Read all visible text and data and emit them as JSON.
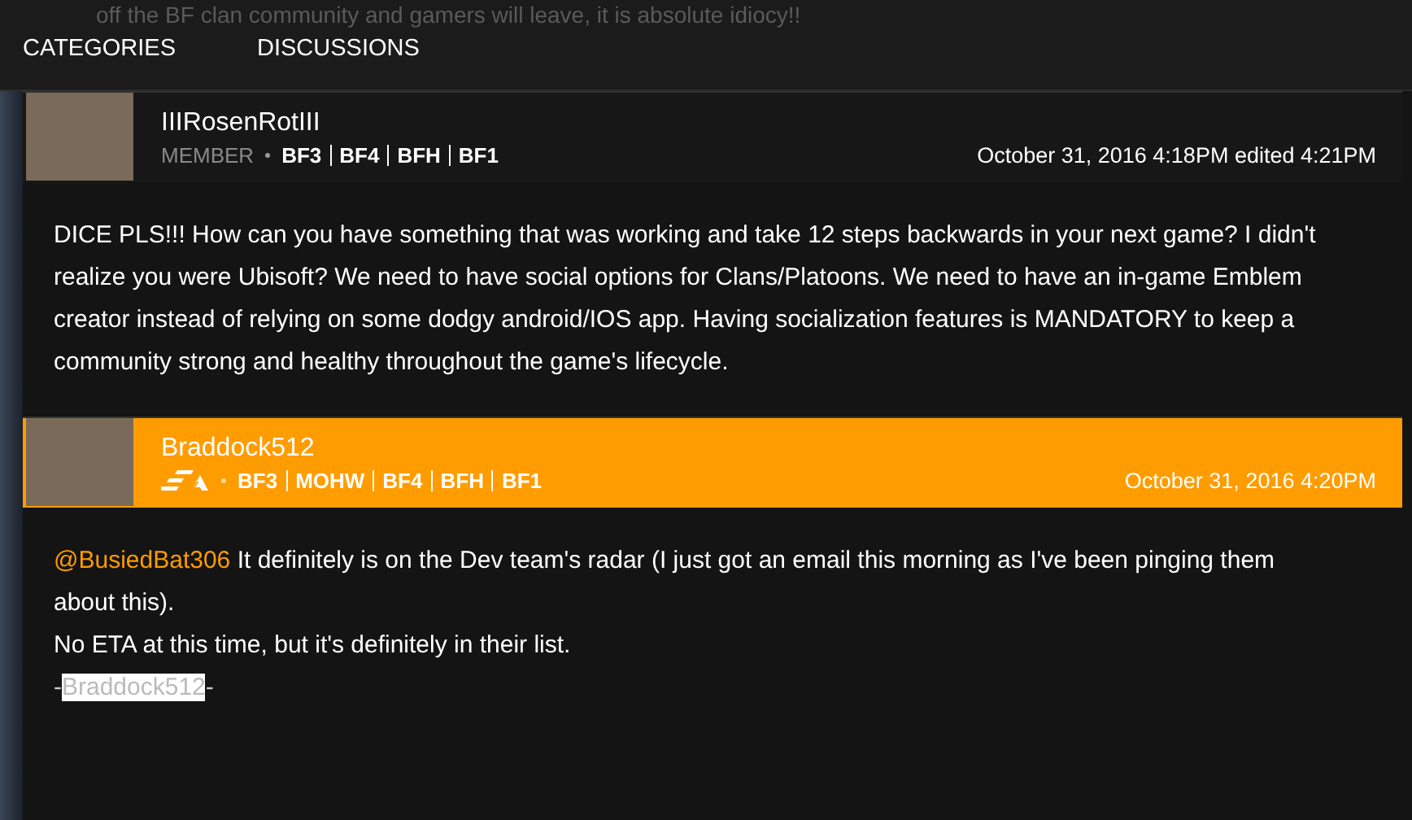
{
  "behind_text": "off the BF clan community and gamers will leave, it is absolute idiocy!!",
  "nav": {
    "items": [
      {
        "label": "CATEGORIES"
      },
      {
        "label": "DISCUSSIONS"
      }
    ]
  },
  "posts": [
    {
      "kind": "member",
      "author": "IIIRosenRotIII",
      "role": "MEMBER",
      "games": [
        "BF3",
        "BF4",
        "BFH",
        "BF1"
      ],
      "date": "October 31, 2016 4:18PM edited 4:21PM",
      "paragraphs": [
        {
          "text": "DICE PLS!!! How can you have something that was working and take 12 steps backwards in your next game? I didn't realize you were Ubisoft? We need to have social options for Clans/Platoons. We need to have an in-game Emblem creator instead of relying on some dodgy android/IOS app. Having socialization features is MANDATORY to keep a community strong and healthy throughout the game's lifecycle."
        }
      ]
    },
    {
      "kind": "staff",
      "author": "Braddock512",
      "games": [
        "BF3",
        "MOHW",
        "BF4",
        "BFH",
        "BF1"
      ],
      "date": "October 31, 2016 4:20PM",
      "paragraphs": [
        {
          "mention": "@BusiedBat306",
          "text": "It definitely is on the Dev team's radar (I just got an email this morning as I've been pinging them about this)."
        },
        {
          "text": "No ETA at this time, but it's definitely in their list."
        }
      ],
      "signature": {
        "before": "-",
        "name": "Braddock512",
        "after": "-",
        "highlighted": true
      }
    }
  ]
}
